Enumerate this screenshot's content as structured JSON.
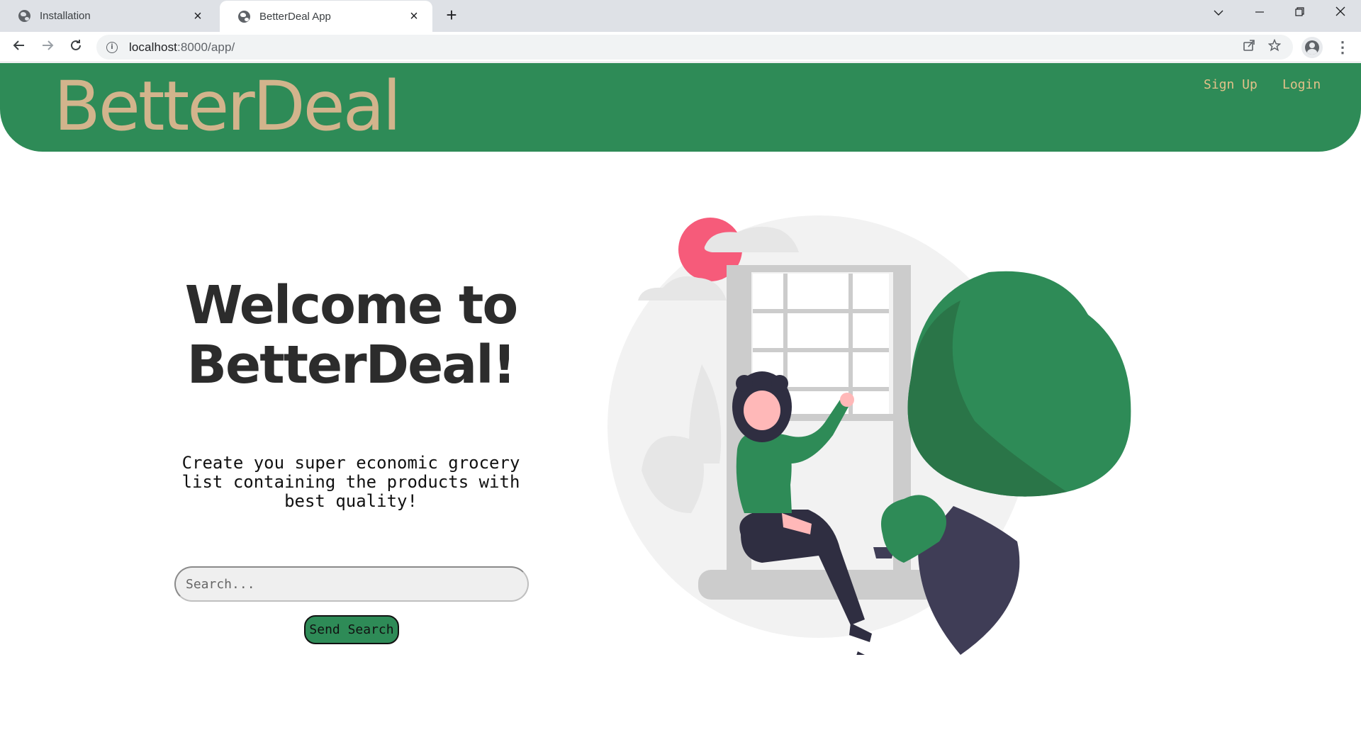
{
  "browser": {
    "tabs": [
      {
        "title": "Installation",
        "active": false
      },
      {
        "title": "BetterDeal App",
        "active": true
      }
    ],
    "url_host": "localhost",
    "url_path": ":8000/app/"
  },
  "header": {
    "brand": "BetterDeal",
    "nav": {
      "signup": "Sign Up",
      "login": "Login"
    }
  },
  "hero": {
    "title_line1": "Welcome to",
    "title_line2": "BetterDeal!",
    "subtitle_line1": "Create you super economic grocery",
    "subtitle_line2": "list containing the products with",
    "subtitle_line3": "best quality!",
    "search_placeholder": "Search...",
    "search_button": "Send Search"
  },
  "colors": {
    "header_bg": "#2e8b57",
    "brand": "#d2b48c",
    "nav_link": "#e3c189",
    "button_bg": "#2e8b57"
  },
  "icons": [
    "globe-icon",
    "close-icon",
    "plus-icon",
    "back-icon",
    "forward-icon",
    "reload-icon",
    "info-icon",
    "share-icon",
    "star-icon",
    "profile-icon",
    "menu-icon"
  ]
}
